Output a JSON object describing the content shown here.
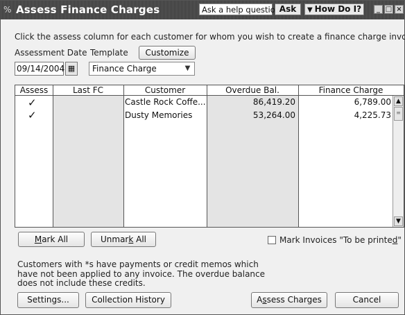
{
  "window": {
    "title": "Assess Finance Charges",
    "help_placeholder": "Ask a help question",
    "ask_label": "Ask",
    "how_do_i_label": "How Do I?"
  },
  "instructions": "Click the assess column for each customer for whom you wish to create a finance charge invoice.",
  "form": {
    "assessment_date_label": "Assessment Date",
    "assessment_date_value": "09/14/2004",
    "template_label": "Template",
    "template_value": "Finance Charge",
    "customize_label": "Customize"
  },
  "table": {
    "columns": [
      "Assess",
      "Last FC",
      "Customer",
      "Overdue Bal.",
      "Finance Charge"
    ],
    "rows": [
      {
        "assess": "✓",
        "last_fc": "",
        "customer": "Castle Rock Coffe...",
        "overdue": "86,419.20",
        "finance_charge": "6,789.00"
      },
      {
        "assess": "✓",
        "last_fc": "",
        "customer": "Dusty Memories",
        "overdue": "53,264.00",
        "finance_charge": "4,225.73"
      }
    ]
  },
  "buttons": {
    "mark_all_prefix": "",
    "mark_all_u": "M",
    "mark_all_rest": "ark All",
    "unmark_all_pre": "Unmar",
    "unmark_all_u": "k",
    "unmark_all_rest": " All",
    "settings": "Settings...",
    "collection_history": "Collection History",
    "assess_pre": "A",
    "assess_u": "s",
    "assess_rest": "sess Charges",
    "cancel": "Cancel"
  },
  "mark_invoices": {
    "pre": "Mark Invoices \"To be printe",
    "u": "d",
    "post": "\""
  },
  "note": "Customers with *s have payments or credit memos which have not been applied to any invoice.  The overdue balance does not include these credits.",
  "icons": {
    "app": "finance-charge-icon",
    "calendar": "calendar-icon",
    "dropdown": "chevron-down-icon"
  }
}
